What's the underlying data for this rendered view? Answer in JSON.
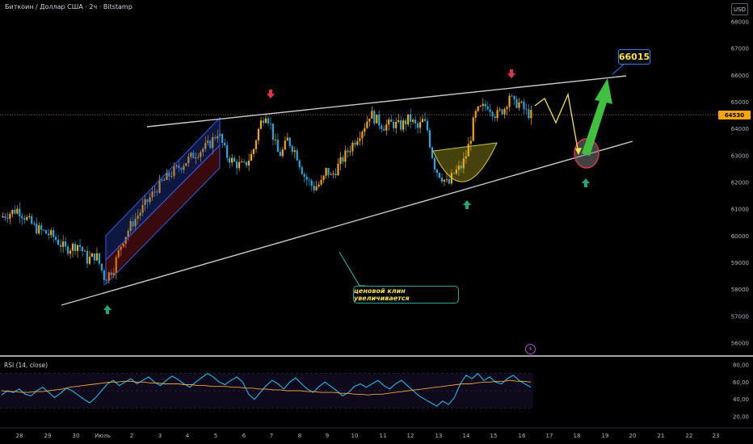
{
  "header": {
    "title": "Биткоин / Доллар США · 2ч · Bitstamp",
    "currency": "USD"
  },
  "price_tag": "64530",
  "target_label": "66015",
  "annotation": "ценовой клин увеличивается",
  "rsi_label": "RSI (14, close)",
  "bolt_glyph": "⚡",
  "colors": {
    "up": "#f7a600",
    "down": "#26a7de",
    "rsi_line": "#22b8e8",
    "rsi_ma": "#f2a43a",
    "wedge": "#c8c8c8",
    "arrow_up": "#1fa67a",
    "arrow_down": "#e0334a",
    "target_arrow": "#3fc13f",
    "projection": "#f5e24a"
  },
  "chart_data": [
    {
      "type": "candlestick",
      "title": "Биткоин / Доллар США · 2ч · Bitstamp",
      "y_axis_side": "right",
      "ylim": [
        55700,
        68200
      ],
      "y_ticks": [
        "68000",
        "67000",
        "66000",
        "65000",
        "64000",
        "63000",
        "62000",
        "61000",
        "60000",
        "59000",
        "58000",
        "57000",
        "56000"
      ],
      "x_ticks": [
        "28",
        "29",
        "30",
        "Июль",
        "2",
        "3",
        "4",
        "5",
        "6",
        "7",
        "8",
        "9",
        "10",
        "11",
        "12",
        "13",
        "14",
        "15",
        "16",
        "17",
        "18",
        "19",
        "20",
        "21",
        "22",
        "23"
      ],
      "last_price": 64530,
      "target_price": 66015,
      "close_path": [
        [
          0,
          60700
        ],
        [
          4,
          61000
        ],
        [
          8,
          60300
        ],
        [
          12,
          60000
        ],
        [
          15,
          59500
        ],
        [
          18,
          59700
        ],
        [
          20,
          59100
        ],
        [
          22,
          59300
        ],
        [
          24,
          58400
        ],
        [
          26,
          58800
        ],
        [
          28,
          59800
        ],
        [
          30,
          60400
        ],
        [
          33,
          61100
        ],
        [
          36,
          61800
        ],
        [
          39,
          62300
        ],
        [
          42,
          62700
        ],
        [
          45,
          63100
        ],
        [
          48,
          63400
        ],
        [
          50,
          63900
        ],
        [
          52,
          63000
        ],
        [
          54,
          62700
        ],
        [
          56,
          62600
        ],
        [
          58,
          63100
        ],
        [
          59,
          63800
        ],
        [
          60,
          64300
        ],
        [
          61,
          64600
        ],
        [
          62,
          64200
        ],
        [
          63,
          63500
        ],
        [
          64,
          63000
        ],
        [
          65,
          63200
        ],
        [
          66,
          63600
        ],
        [
          68,
          63100
        ],
        [
          69,
          62600
        ],
        [
          70,
          62200
        ],
        [
          72,
          61800
        ],
        [
          74,
          62000
        ],
        [
          75,
          62500
        ],
        [
          76,
          62200
        ],
        [
          78,
          62700
        ],
        [
          80,
          63200
        ],
        [
          82,
          63700
        ],
        [
          84,
          64200
        ],
        [
          85,
          64600
        ],
        [
          86,
          64400
        ],
        [
          88,
          64100
        ],
        [
          90,
          64200
        ],
        [
          92,
          64100
        ],
        [
          94,
          64400
        ],
        [
          96,
          64000
        ],
        [
          97,
          64300
        ],
        [
          98,
          64100
        ],
        [
          99,
          63200
        ],
        [
          100,
          62500
        ],
        [
          102,
          62100
        ],
        [
          103,
          61900
        ],
        [
          104,
          62300
        ],
        [
          106,
          62600
        ],
        [
          107,
          63000
        ],
        [
          108,
          63600
        ],
        [
          109,
          64500
        ],
        [
          110,
          64700
        ],
        [
          112,
          64900
        ],
        [
          114,
          64500
        ],
        [
          116,
          64800
        ],
        [
          117,
          65300
        ],
        [
          118,
          64900
        ],
        [
          119,
          65000
        ],
        [
          120,
          64800
        ],
        [
          121,
          64600
        ],
        [
          122,
          64530
        ]
      ]
    },
    {
      "type": "line",
      "title": "RSI (14, close)",
      "ylim": [
        20,
        80
      ],
      "y_ticks": [
        "80,00",
        "60,00",
        "40,00",
        "20,00"
      ],
      "series": [
        {
          "values": [
            45,
            50,
            48,
            52,
            46,
            44,
            50,
            54,
            48,
            42,
            47,
            53,
            50,
            45,
            40,
            36,
            42,
            50,
            58,
            62,
            56,
            60,
            64,
            58,
            62,
            66,
            60,
            56,
            62,
            67,
            63,
            58,
            54,
            60,
            65,
            70,
            66,
            60,
            57,
            62,
            66,
            60,
            46,
            40,
            48,
            56,
            62,
            58,
            52,
            60,
            65,
            58,
            52,
            48,
            55,
            60,
            55,
            50,
            44,
            48,
            55,
            58,
            54,
            58,
            62,
            56,
            52,
            58,
            62,
            56,
            50,
            44,
            40,
            36,
            32,
            38,
            34,
            42,
            58,
            68,
            64,
            70,
            62,
            66,
            60,
            58,
            64,
            68,
            62,
            58,
            54
          ]
        },
        {
          "values": [
            50,
            49,
            49,
            48,
            48,
            49,
            49,
            50,
            51,
            52,
            54,
            55,
            56,
            57,
            58,
            59,
            60,
            60,
            61,
            61,
            60,
            60,
            59,
            59,
            58,
            58,
            58,
            57,
            57,
            56,
            56,
            55,
            55,
            55,
            54,
            54,
            53,
            53,
            52,
            52,
            51,
            51,
            50,
            50,
            50,
            49,
            49,
            48,
            48,
            48,
            47,
            47,
            46,
            46,
            45,
            46,
            46,
            47,
            48,
            49,
            50,
            51,
            52,
            53,
            54,
            55,
            56,
            57,
            58,
            58,
            59,
            60,
            60,
            61,
            61,
            62,
            61,
            61,
            60
          ]
        }
      ]
    }
  ]
}
